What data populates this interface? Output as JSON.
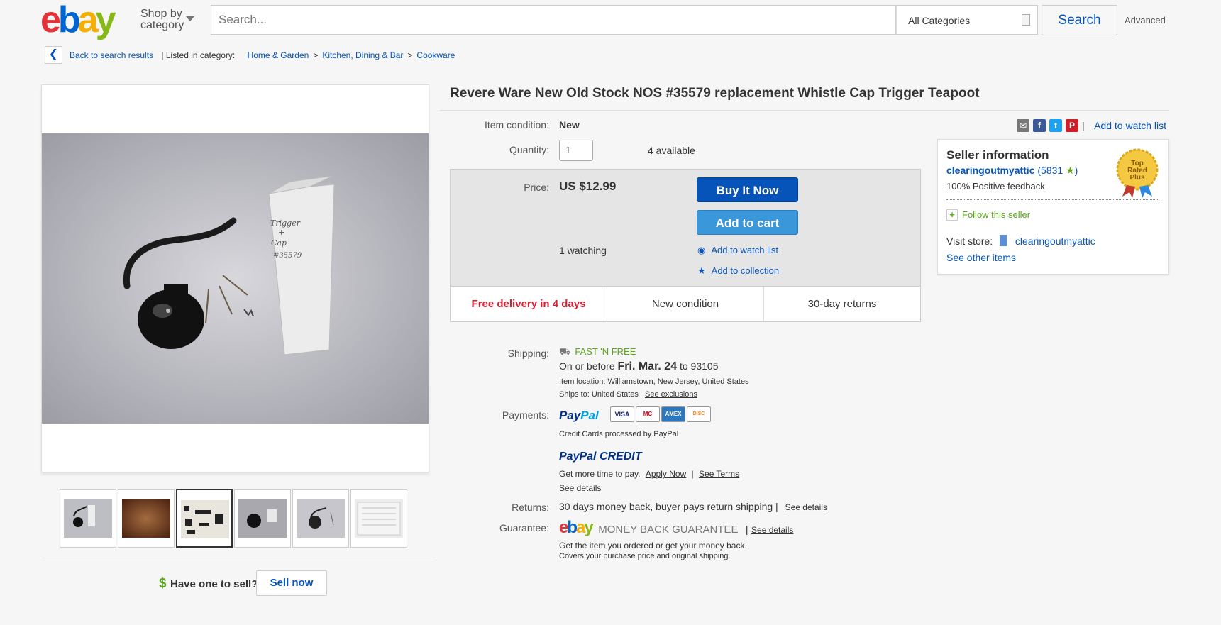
{
  "header": {
    "logo": {
      "e": "e",
      "b": "b",
      "a": "a",
      "y": "y"
    },
    "shop_by": "Shop by\ncategory",
    "search_placeholder": "Search...",
    "category": "All Categories",
    "search_button": "Search",
    "advanced": "Advanced"
  },
  "breadcrumb": {
    "back": "Back to search results",
    "listed_in": "| Listed in category:",
    "cat1": "Home & Garden",
    "cat2": "Kitchen, Dining & Bar",
    "cat3": "Cookware",
    "sep": ">"
  },
  "photo": {
    "box_text_1": "Trigger",
    "box_text_2": "+",
    "box_text_3": "Cap",
    "box_text_4": "#35579"
  },
  "sell": {
    "dollar": "$",
    "prompt": "Have one to sell?",
    "button": "Sell now"
  },
  "item": {
    "title": "Revere Ware New Old Stock NOS #35579 replacement Whistle Cap Trigger Teapoot",
    "condition_label": "Item condition:",
    "condition": "New",
    "quantity_label": "Quantity:",
    "quantity": "1",
    "available": "4 available",
    "price_label": "Price:",
    "price": "US $12.99",
    "buy_now": "Buy It Now",
    "add_to_cart": "Add to cart",
    "watching": "1 watching",
    "add_watch": "Add to watch list",
    "add_collection": "Add to collection",
    "free_delivery": "Free delivery in 4 days",
    "new_condition": "New condition",
    "returns_30": "30-day returns"
  },
  "share": {
    "watch_link": "Add to watch list",
    "sep": "|",
    "facebook": "f",
    "twitter": "t",
    "pinterest": "P"
  },
  "seller": {
    "heading": "Seller information",
    "name": "clearingoutmyattic",
    "score_open": "(",
    "score": "5831",
    "score_close": ")",
    "feedback": "100% Positive feedback",
    "follow": "Follow this seller",
    "visit_label": "Visit store:",
    "store": "clearingoutmyattic",
    "other": "See other items",
    "badge": "Top\nRated\nPlus"
  },
  "shipping": {
    "label": "Shipping:",
    "method": "FAST 'N FREE",
    "eta_prefix": "On or before",
    "eta_date": "Fri. Mar. 24",
    "eta_to": "to 93105",
    "location_label": "Item location:",
    "location": "Williamstown, New Jersey, United States",
    "ships_label": "Ships to:",
    "ships_to": "United States",
    "exclusions": "See exclusions"
  },
  "payments": {
    "label": "Payments:",
    "paypal_a": "Pay",
    "paypal_b": "Pal",
    "cards": [
      "VISA",
      "MC",
      "AMEX",
      "DISC"
    ],
    "processed": "Credit Cards processed by PayPal",
    "credit_a": "PayPal",
    "credit_b": "CREDIT",
    "more_time": "Get more time to pay.",
    "apply": "Apply Now",
    "sep": "|",
    "terms": "See Terms",
    "details": "See details"
  },
  "returns": {
    "label": "Returns:",
    "text": "30 days money back, buyer pays return shipping |",
    "details": "See details"
  },
  "guarantee": {
    "label": "Guarantee:",
    "mbg": "MONEY BACK GUARANTEE",
    "sep": "|",
    "details": "See details",
    "line1": "Get the item you ordered or get your money back.",
    "line2": "Covers your purchase price and original shipping."
  }
}
